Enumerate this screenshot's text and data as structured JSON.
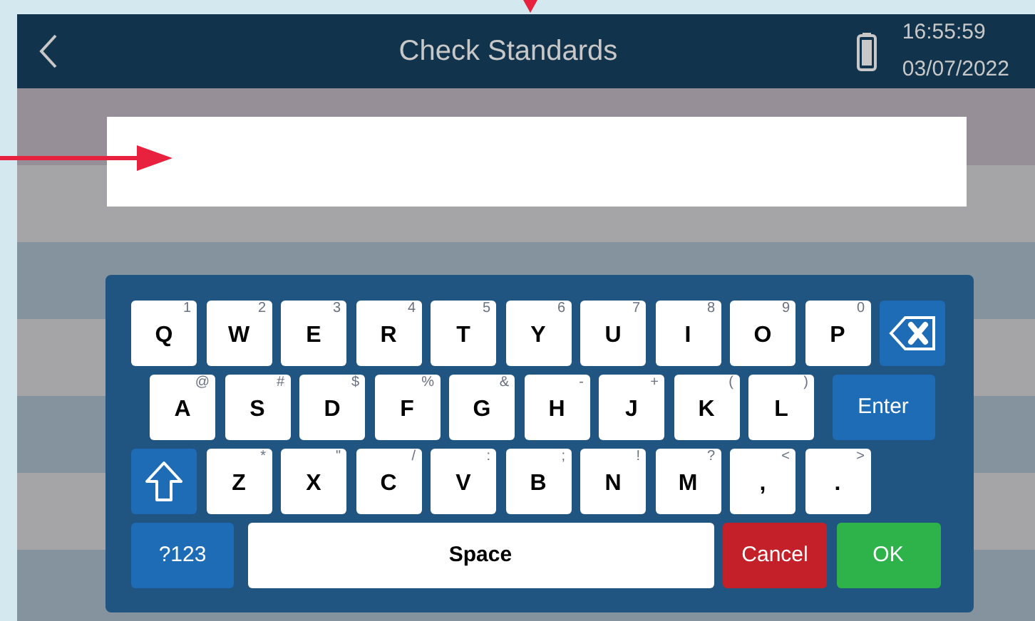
{
  "header": {
    "title": "Check Standards",
    "time": "16:55:59",
    "date": "03/07/2022"
  },
  "keyboard": {
    "rows": [
      [
        {
          "kind": "char",
          "label": "Q",
          "alt": "1"
        },
        {
          "kind": "char",
          "label": "W",
          "alt": "2"
        },
        {
          "kind": "char",
          "label": "E",
          "alt": "3"
        },
        {
          "kind": "char",
          "label": "R",
          "alt": "4"
        },
        {
          "kind": "char",
          "label": "T",
          "alt": "5"
        },
        {
          "kind": "char",
          "label": "Y",
          "alt": "6"
        },
        {
          "kind": "char",
          "label": "U",
          "alt": "7"
        },
        {
          "kind": "char",
          "label": "I",
          "alt": "8"
        },
        {
          "kind": "char",
          "label": "O",
          "alt": "9"
        },
        {
          "kind": "char",
          "label": "P",
          "alt": "0"
        },
        {
          "kind": "backspace"
        }
      ],
      [
        {
          "kind": "char",
          "label": "A",
          "alt": "@"
        },
        {
          "kind": "char",
          "label": "S",
          "alt": "#"
        },
        {
          "kind": "char",
          "label": "D",
          "alt": "$"
        },
        {
          "kind": "char",
          "label": "F",
          "alt": "%"
        },
        {
          "kind": "char",
          "label": "G",
          "alt": "&"
        },
        {
          "kind": "char",
          "label": "H",
          "alt": "-"
        },
        {
          "kind": "char",
          "label": "J",
          "alt": "+"
        },
        {
          "kind": "char",
          "label": "K",
          "alt": "("
        },
        {
          "kind": "char",
          "label": "L",
          "alt": ")"
        },
        {
          "kind": "enter",
          "label": "Enter"
        }
      ],
      [
        {
          "kind": "shift"
        },
        {
          "kind": "char",
          "label": "Z",
          "alt": "*"
        },
        {
          "kind": "char",
          "label": "X",
          "alt": "\""
        },
        {
          "kind": "char",
          "label": "C",
          "alt": "/"
        },
        {
          "kind": "char",
          "label": "V",
          "alt": ":"
        },
        {
          "kind": "char",
          "label": "B",
          "alt": ";"
        },
        {
          "kind": "char",
          "label": "N",
          "alt": "!"
        },
        {
          "kind": "char",
          "label": "M",
          "alt": "?"
        },
        {
          "kind": "char",
          "label": ",",
          "alt": "<"
        },
        {
          "kind": "char",
          "label": ".",
          "alt": ">"
        }
      ]
    ],
    "action_bar": [
      {
        "kind": "symbols",
        "label": "?123"
      },
      {
        "kind": "space",
        "label": "Space"
      },
      {
        "kind": "cancel",
        "label": "Cancel"
      },
      {
        "kind": "ok",
        "label": "OK"
      }
    ]
  }
}
